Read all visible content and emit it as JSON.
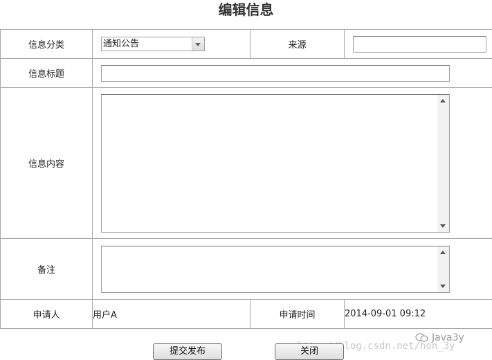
{
  "title": "编辑信息",
  "form": {
    "category_label": "信息分类",
    "category_value": "通知公告",
    "source_label": "来源",
    "source_value": "",
    "subject_label": "信息标题",
    "subject_value": "",
    "content_label": "信息内容",
    "content_value": "",
    "remark_label": "备注",
    "remark_value": "",
    "applicant_label": "申请人",
    "applicant_value": "用户A",
    "apply_time_label": "申请时间",
    "apply_time_value": "2014-09-01 09:12"
  },
  "buttons": {
    "submit_label": "提交发布",
    "close_label": "关闭"
  },
  "watermark": {
    "url": "http://blog.csdn.net/hon_3y",
    "brand": "Java3y"
  }
}
